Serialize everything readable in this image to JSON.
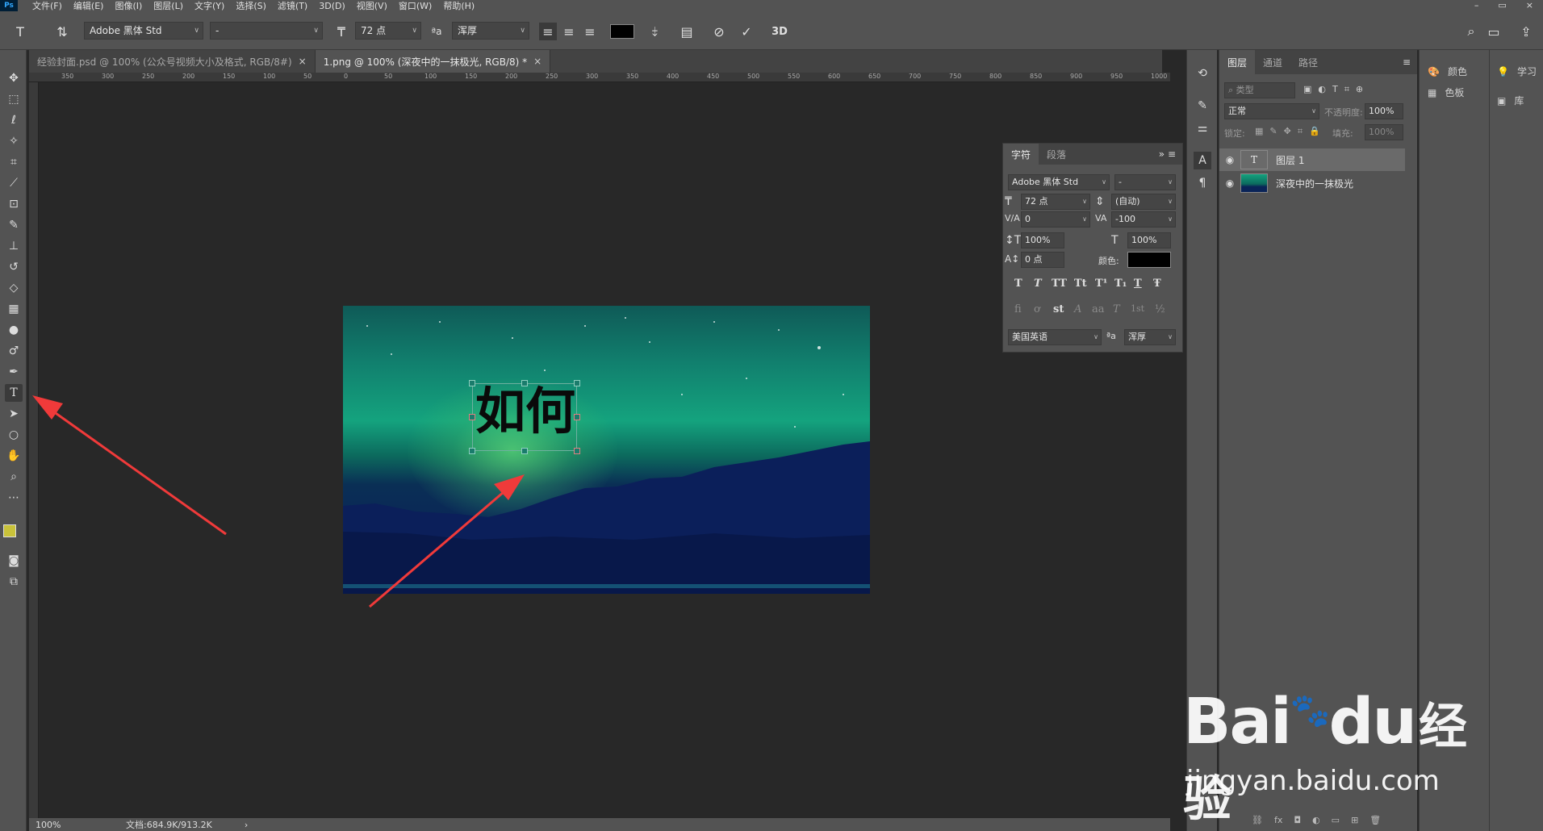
{
  "menu": [
    "文件(F)",
    "编辑(E)",
    "图像(I)",
    "图层(L)",
    "文字(Y)",
    "选择(S)",
    "滤镜(T)",
    "3D(D)",
    "视图(V)",
    "窗口(W)",
    "帮助(H)"
  ],
  "app_icon": "Ps",
  "window_controls": [
    "–",
    "▭",
    "×"
  ],
  "options": {
    "font_family": "Adobe 黑体 Std",
    "font_style": "-",
    "font_size": "72 点",
    "aa_label": "ªa",
    "antialias": "浑厚",
    "label_3d": "3D"
  },
  "tabs": [
    {
      "label": "经验封面.psd @ 100% (公众号视频大小及格式, RGB/8#)",
      "close": "×"
    },
    {
      "label": "1.png @ 100% (深夜中的一抹极光, RGB/8) *",
      "close": "×"
    }
  ],
  "ruler_h": [
    "350",
    "300",
    "250",
    "200",
    "150",
    "100",
    "50",
    "0",
    "50",
    "100",
    "150",
    "200",
    "250",
    "300",
    "350",
    "400",
    "450",
    "500",
    "550",
    "600",
    "650",
    "700",
    "750",
    "800",
    "850",
    "900",
    "950",
    "1000"
  ],
  "canvas_text": "如何",
  "status": {
    "zoom": "100%",
    "doc": "文档:684.9K/913.2K",
    "arrow": "›"
  },
  "char_panel": {
    "tabs": [
      "字符",
      "段落"
    ],
    "font_family": "Adobe 黑体 Std",
    "font_style": "-",
    "size": "72 点",
    "leading": "(自动)",
    "kerning": "0",
    "tracking": "-100",
    "vscale": "100%",
    "hscale": "100%",
    "baseline": "0 点",
    "color_label": "颜色:",
    "language": "美国英语",
    "aa_label": "ªa",
    "antialias": "浑厚",
    "style_buttons": [
      "T",
      "T",
      "TT",
      "Tt",
      "T¹",
      "T₁",
      "T",
      "Ŧ"
    ],
    "ot_buttons": [
      "fi",
      "ơ",
      "st",
      "A",
      "aa",
      "T",
      "1st",
      "½"
    ]
  },
  "layers_panel": {
    "tabs": [
      "图层",
      "通道",
      "路径"
    ],
    "filter_placeholder": "类型",
    "blend_mode": "正常",
    "opacity_label": "不透明度:",
    "opacity": "100%",
    "lock_label": "锁定:",
    "fill_label": "填充:",
    "fill": "100%",
    "layers": [
      {
        "name": "图层 1",
        "type": "text",
        "thumb_glyph": "T",
        "selected": true
      },
      {
        "name": "深夜中的一抹极光",
        "type": "image",
        "selected": false
      }
    ],
    "footer_icons": [
      "link-icon",
      "fx-icon",
      "mask-icon",
      "adjustment-icon",
      "folder-icon",
      "new-layer-icon",
      "trash-icon"
    ],
    "footer_glyphs": [
      "⛓",
      "fx",
      "◘",
      "◐",
      "▭",
      "⊞",
      "🗑"
    ]
  },
  "far_right": {
    "items": [
      {
        "label": "颜色",
        "icon": "palette-icon"
      },
      {
        "label": "色板",
        "icon": "swatches-icon"
      }
    ],
    "items2": [
      {
        "label": "学习",
        "icon": "bulb-icon"
      },
      {
        "label": "库",
        "icon": "library-icon"
      }
    ]
  },
  "watermark": {
    "brand": "Bai",
    "brand2": "du",
    "cn": "经验",
    "url": "jingyan.baidu.com"
  },
  "colors": {
    "panel": "#535353",
    "canvas": "#282828",
    "arrow": "#f03a3a",
    "fg_swatch": "#c9c23a"
  }
}
